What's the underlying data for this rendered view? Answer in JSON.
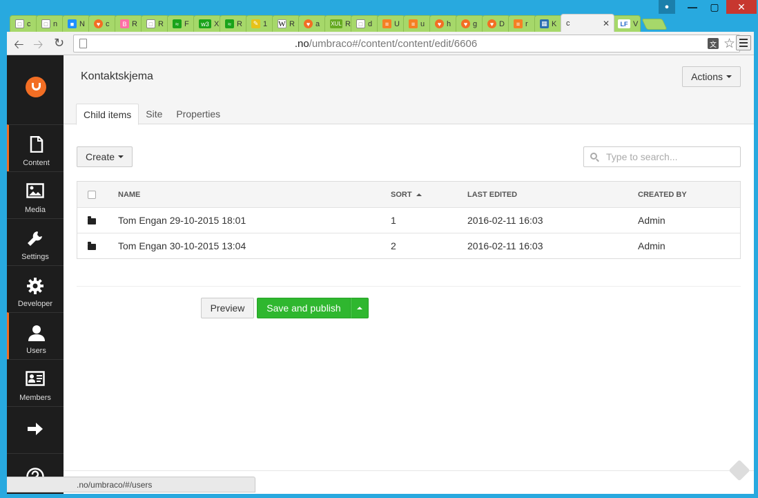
{
  "browser": {
    "tabs": [
      {
        "letter": "c",
        "icon": "page-icon",
        "color": "#888888"
      },
      {
        "letter": "n",
        "icon": "page-icon",
        "color": "#888888"
      },
      {
        "letter": "N",
        "icon": "app-icon",
        "color": "#1e90ff"
      },
      {
        "letter": "c",
        "icon": "heart-icon",
        "color": "#f26e24"
      },
      {
        "letter": "R",
        "icon": "b-icon",
        "color": "#ff6fa5"
      },
      {
        "letter": "R",
        "icon": "page-icon",
        "color": "#888888"
      },
      {
        "letter": "F",
        "icon": "rss-icon",
        "color": "#1aa31a"
      },
      {
        "letter": "X",
        "icon": "w3-icon",
        "color": "#1aa31a"
      },
      {
        "letter": "R",
        "icon": "rss-icon",
        "color": "#1aa31a"
      },
      {
        "letter": "1",
        "icon": "note-icon",
        "color": "#e6c21a"
      },
      {
        "letter": "R",
        "icon": "wikipedia-icon",
        "color": "#ffffff"
      },
      {
        "letter": "a",
        "icon": "heart-icon",
        "color": "#f26e24"
      },
      {
        "letter": "R",
        "icon": "xul-icon",
        "color": "#66aa22"
      },
      {
        "letter": "d",
        "icon": "page-icon",
        "color": "#888888"
      },
      {
        "letter": "U",
        "icon": "stack-icon",
        "color": "#f48024"
      },
      {
        "letter": "u",
        "icon": "stack-icon",
        "color": "#f48024"
      },
      {
        "letter": "h",
        "icon": "heart-icon",
        "color": "#f26e24"
      },
      {
        "letter": "g",
        "icon": "heart-icon",
        "color": "#f26e24"
      },
      {
        "letter": "D",
        "icon": "heart-icon",
        "color": "#f26e24"
      },
      {
        "letter": "r",
        "icon": "stack-icon",
        "color": "#f48024"
      },
      {
        "letter": "K",
        "icon": "cube-icon",
        "color": "#2a6fb0"
      }
    ],
    "active_tab": {
      "title": "c"
    },
    "after_tab": {
      "letter": "V",
      "icon": "lf-icon",
      "color": "#1e66c8"
    },
    "url": {
      "domain": ".no",
      "path": "/umbraco#/content/content/edit/6606"
    },
    "status_url": ".no/umbraco/#/users"
  },
  "sidebar": {
    "sections": [
      {
        "label": "Content",
        "icon": "document-icon"
      },
      {
        "label": "Media",
        "icon": "picture-icon"
      },
      {
        "label": "Settings",
        "icon": "wrench-icon"
      },
      {
        "label": "Developer",
        "icon": "gear-icon"
      },
      {
        "label": "Users",
        "icon": "user-icon"
      },
      {
        "label": "Members",
        "icon": "id-card-icon"
      },
      {
        "label": "",
        "icon": "arrow-right-icon"
      },
      {
        "label": "",
        "icon": "help-icon"
      }
    ]
  },
  "header": {
    "title": "Kontaktskjema",
    "actions_label": "Actions"
  },
  "tabs": [
    "Child items",
    "Site",
    "Properties"
  ],
  "listview": {
    "create_label": "Create",
    "search_placeholder": "Type to search...",
    "columns": [
      "NAME",
      "SORT",
      "LAST EDITED",
      "CREATED BY"
    ],
    "rows": [
      {
        "name": "Tom Engan 29-10-2015 18:01",
        "sort": "1",
        "last_edited": "2016-02-11 16:03",
        "created_by": "Admin"
      },
      {
        "name": "Tom Engan 30-10-2015 13:04",
        "sort": "2",
        "last_edited": "2016-02-11 16:03",
        "created_by": "Admin"
      }
    ]
  },
  "buttons": {
    "preview": "Preview",
    "save_publish": "Save and publish"
  },
  "colors": {
    "accent": "#f26e24",
    "publish_green": "#2fb72f",
    "sidebar_bg": "#1d1d1d",
    "window_frame": "#28a9df"
  }
}
